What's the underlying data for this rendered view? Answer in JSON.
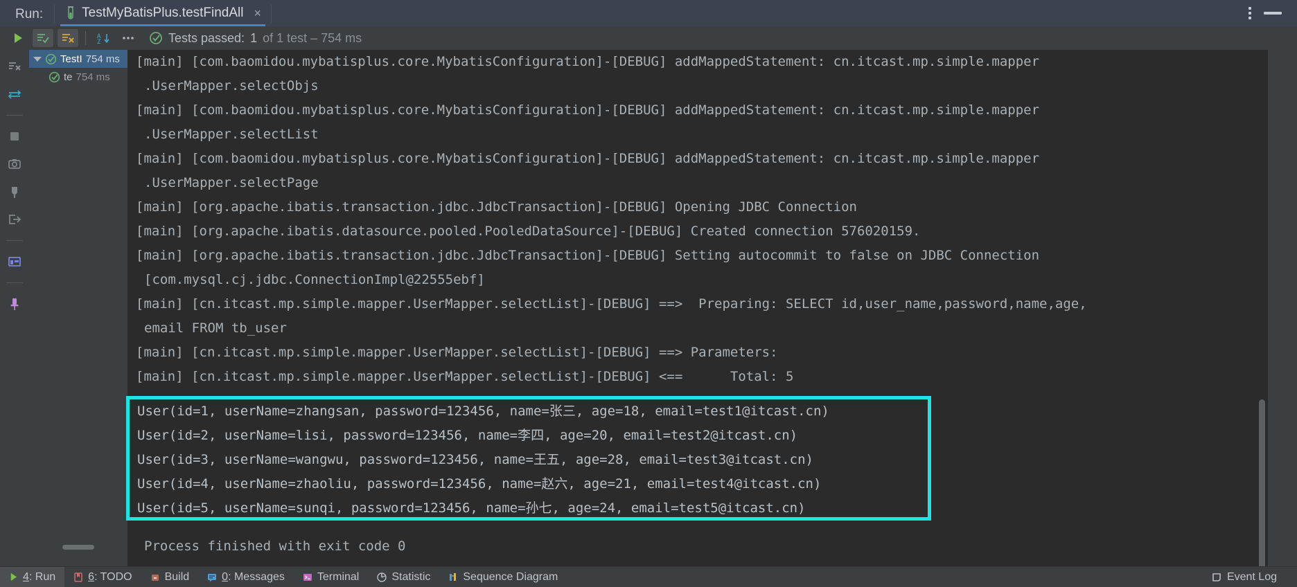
{
  "window": {
    "run_label": "Run:",
    "tab_title": "TestMyBatisPlus.testFindAll",
    "tab_close": "×"
  },
  "toolbar": {
    "rerun": "rerun-icon",
    "show_passed": "show-passed-tests-icon",
    "show_ignored": "hide-ignored-tests-icon",
    "sort_alpha": "sort-alphabetically-icon",
    "more": "•••",
    "status_prefix": "Tests passed: ",
    "status_count": "1",
    "status_suffix": " of 1 test – 754 ms"
  },
  "left_gutter": {
    "items": [
      {
        "name": "filter-tests-icon"
      },
      {
        "name": "expand-collapse-icon"
      },
      {
        "name": "stop-process-icon"
      },
      {
        "name": "screenshot-icon"
      },
      {
        "name": "attach-debugger-icon"
      },
      {
        "name": "export-test-results-icon"
      },
      {
        "name": "layout-toggle-icon"
      },
      {
        "name": "pin-tab-icon"
      }
    ]
  },
  "right_gutter": {
    "items": [
      {
        "name": "highlighter-pen-icon"
      },
      {
        "name": "sort-descending-icon"
      },
      {
        "name": "scroll-up-icon"
      },
      {
        "name": "scroll-down-icon"
      },
      {
        "name": "soft-wrap-icon"
      },
      {
        "name": "scroll-to-end-icon"
      },
      {
        "name": "print-icon"
      },
      {
        "name": "trash-icon"
      }
    ]
  },
  "test_tree": {
    "rows": [
      {
        "label": "TestI",
        "time": "754 ms",
        "selected": true,
        "indent": false
      },
      {
        "label": "te",
        "time": "754 ms",
        "selected": false,
        "indent": true
      }
    ]
  },
  "console": {
    "lines": [
      {
        "text": "[main] [com.baomidou.mybatisplus.core.MybatisConfiguration]-[DEBUG] addMappedStatement: cn.itcast.mp.simple.mapper",
        "cont": false
      },
      {
        "text": ".UserMapper.selectObjs",
        "cont": true
      },
      {
        "text": "[main] [com.baomidou.mybatisplus.core.MybatisConfiguration]-[DEBUG] addMappedStatement: cn.itcast.mp.simple.mapper",
        "cont": false
      },
      {
        "text": ".UserMapper.selectList",
        "cont": true
      },
      {
        "text": "[main] [com.baomidou.mybatisplus.core.MybatisConfiguration]-[DEBUG] addMappedStatement: cn.itcast.mp.simple.mapper",
        "cont": false
      },
      {
        "text": ".UserMapper.selectPage",
        "cont": true
      },
      {
        "text": "[main] [org.apache.ibatis.transaction.jdbc.JdbcTransaction]-[DEBUG] Opening JDBC Connection",
        "cont": false
      },
      {
        "text": "[main] [org.apache.ibatis.datasource.pooled.PooledDataSource]-[DEBUG] Created connection 576020159.",
        "cont": false
      },
      {
        "text": "[main] [org.apache.ibatis.transaction.jdbc.JdbcTransaction]-[DEBUG] Setting autocommit to false on JDBC Connection",
        "cont": false
      },
      {
        "text": "[com.mysql.cj.jdbc.ConnectionImpl@22555ebf]",
        "cont": true
      },
      {
        "text": "[main] [cn.itcast.mp.simple.mapper.UserMapper.selectList]-[DEBUG] ==>  Preparing: SELECT id,user_name,password,name,age,",
        "cont": false
      },
      {
        "text": "email FROM tb_user",
        "cont": true
      },
      {
        "text": "[main] [cn.itcast.mp.simple.mapper.UserMapper.selectList]-[DEBUG] ==> Parameters:",
        "cont": false
      },
      {
        "text": "[main] [cn.itcast.mp.simple.mapper.UserMapper.selectList]-[DEBUG] <==      Total: 5",
        "cont": false
      }
    ],
    "results": [
      "User(id=1, userName=zhangsan, password=123456, name=张三, age=18, email=test1@itcast.cn)",
      "User(id=2, userName=lisi, password=123456, name=李四, age=20, email=test2@itcast.cn)",
      "User(id=3, userName=wangwu, password=123456, name=王五, age=28, email=test3@itcast.cn)",
      "User(id=4, userName=zhaoliu, password=123456, name=赵六, age=21, email=test4@itcast.cn)",
      "User(id=5, userName=sunqi, password=123456, name=孙七, age=24, email=test5@itcast.cn)"
    ],
    "footer": "Process finished with exit code 0"
  },
  "highlight": {
    "color": "#1fe3e3"
  },
  "statusbar": {
    "items": [
      {
        "key": "4",
        "label": ": Run",
        "icon": "run-icon",
        "active": true
      },
      {
        "key": "6",
        "label": ": TODO",
        "icon": "todo-icon",
        "active": false
      },
      {
        "key": "",
        "label": "Build",
        "icon": "build-icon",
        "active": false
      },
      {
        "key": "0",
        "label": ": Messages",
        "icon": "messages-icon",
        "active": false
      },
      {
        "key": "",
        "label": "Terminal",
        "icon": "terminal-icon",
        "active": false
      },
      {
        "key": "",
        "label": "Statistic",
        "icon": "statistic-icon",
        "active": false
      },
      {
        "key": "",
        "label": "Sequence Diagram",
        "icon": "sequence-diagram-icon",
        "active": false
      }
    ],
    "event_log": "Event Log"
  }
}
